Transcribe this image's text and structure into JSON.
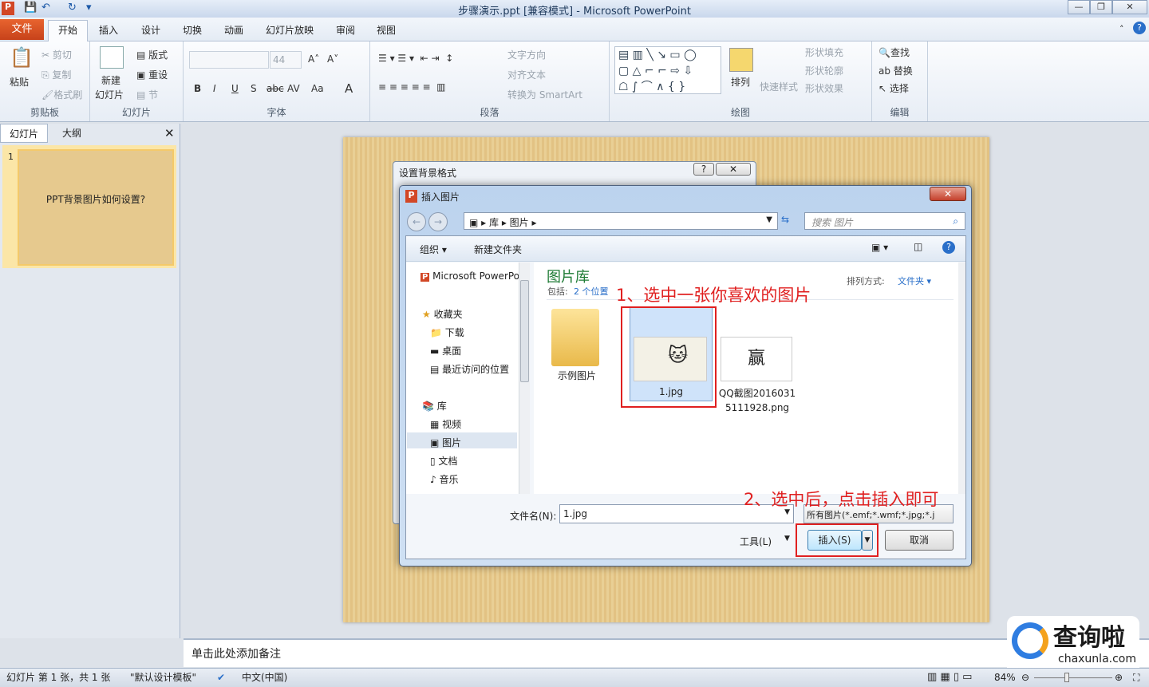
{
  "window": {
    "title": "步骤演示.ppt [兼容模式] - Microsoft PowerPoint",
    "min": "—",
    "restore": "❐",
    "close": "✕"
  },
  "quick_access": {
    "app": "P",
    "save": "💾",
    "undo": "↶",
    "redo": "↻",
    "more": "▾"
  },
  "tabs": [
    "文件",
    "开始",
    "插入",
    "设计",
    "切换",
    "动画",
    "幻灯片放映",
    "审阅",
    "视图"
  ],
  "ribbon": {
    "clipboard": {
      "label": "剪贴板",
      "paste": "粘贴",
      "cut": "剪切",
      "copy": "复制",
      "format_painter": "格式刷"
    },
    "slides": {
      "label": "幻灯片",
      "new_slide_1": "新建",
      "new_slide_2": "幻灯片",
      "layout": "版式",
      "reset": "重设",
      "section": "节"
    },
    "font": {
      "label": "字体",
      "size": "44",
      "bold": "B",
      "italic": "I",
      "underline": "U",
      "shadow": "S",
      "strike": "abc",
      "spacing": "AV",
      "case": "Aa",
      "color": "A",
      "grow": "A˄",
      "shrink": "A˅"
    },
    "paragraph": {
      "label": "段落",
      "text_direction": "文字方向",
      "align_text": "对齐文本",
      "smartart": "转换为 SmartArt"
    },
    "drawing": {
      "label": "绘图",
      "arrange": "排列",
      "quick_styles": "快速样式",
      "fill": "形状填充",
      "outline": "形状轮廓",
      "effects": "形状效果"
    },
    "editing": {
      "label": "编辑",
      "find": "查找",
      "replace": "替换",
      "select": "选择"
    }
  },
  "left_pane": {
    "tab_slides": "幻灯片",
    "tab_outline": "大纲",
    "slide_number": "1",
    "thumb_text": "PPT背景图片如何设置?"
  },
  "notes_placeholder": "单击此处添加备注",
  "status": {
    "slide_info": "幻灯片 第 1 张，共 1 张",
    "theme": "\"默认设计模板\"",
    "language": "中文(中国)",
    "zoom": "84%"
  },
  "bg_dialog": {
    "title": "设置背景格式",
    "help": "?",
    "close": "✕"
  },
  "insert_dialog": {
    "title": "插入图片",
    "breadcrumb": [
      "库",
      "图片"
    ],
    "search_placeholder": "搜索 图片",
    "organize": "组织 ▾",
    "new_folder": "新建文件夹",
    "nav": {
      "ppt": "Microsoft PowerPoint",
      "favorites": "收藏夹",
      "downloads": "下载",
      "desktop": "桌面",
      "recent": "最近访问的位置",
      "libraries": "库",
      "videos": "视频",
      "pictures": "图片",
      "documents": "文档",
      "music": "音乐"
    },
    "library_title": "图片库",
    "includes_label": "包括:",
    "includes_link": "2 个位置",
    "sort_label": "排列方式:",
    "sort_value": "文件夹 ▾",
    "files": [
      {
        "name": "示例图片"
      },
      {
        "name": "1.jpg"
      },
      {
        "name": "QQ截图20160315111928.png"
      }
    ],
    "filename_label": "文件名(N):",
    "filename_value": "1.jpg",
    "filetype": "所有图片(*.emf;*.wmf;*.jpg;*.j",
    "tools": "工具(L)",
    "insert": "插入(S)",
    "cancel": "取消"
  },
  "annotations": {
    "step1": "1、选中一张你喜欢的图片",
    "step2": "2、选中后，点击插入即可"
  },
  "watermark": {
    "cn": "查询啦",
    "url": "chaxunla.com"
  }
}
